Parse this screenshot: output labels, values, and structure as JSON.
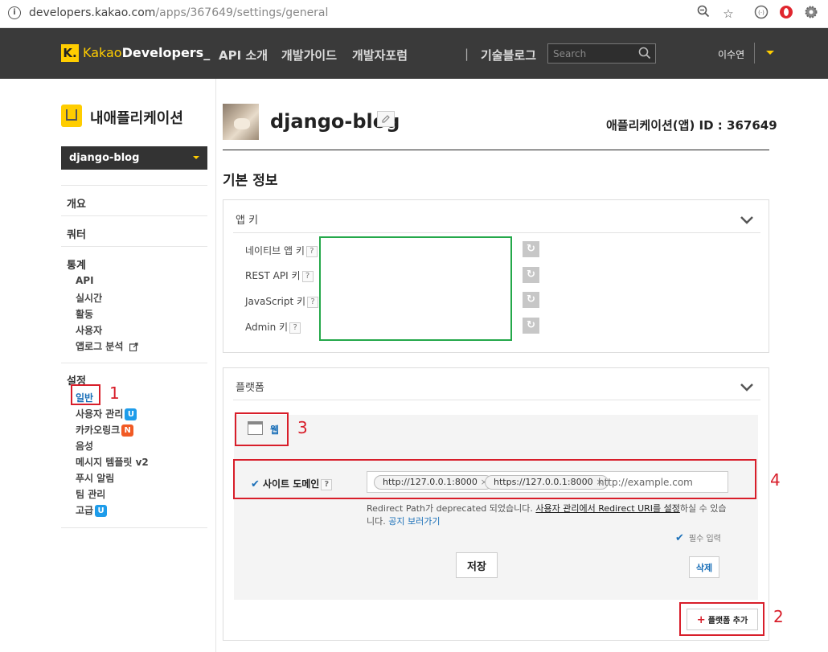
{
  "browser": {
    "url_host": "developers.kakao.com",
    "url_path": "/apps/367649/settings/general"
  },
  "header": {
    "logo_k": "K.",
    "logo_kakao": "Kakao",
    "logo_dev": "Developers_",
    "nav": [
      "API 소개",
      "개발가이드",
      "개발자포럼"
    ],
    "nav_sep": "|",
    "blog": "기술블로그",
    "search_placeholder": "Search",
    "user": "이수연"
  },
  "sidebar": {
    "title": "내애플리케이션",
    "app_select": "django-blog",
    "overview": "개요",
    "quota": "쿼터",
    "stats": {
      "label": "통계",
      "items": [
        "API",
        "실시간",
        "활동",
        "사용자",
        "앱로그 분석"
      ]
    },
    "settings": {
      "label": "설정",
      "items": [
        {
          "label": "일반",
          "badge": ""
        },
        {
          "label": "사용자 관리",
          "badge": "U"
        },
        {
          "label": "카카오링크",
          "badge": "N"
        },
        {
          "label": "음성",
          "badge": ""
        },
        {
          "label": "메시지 템플릿 v2",
          "badge": ""
        },
        {
          "label": "푸시 알림",
          "badge": ""
        },
        {
          "label": "팀 관리",
          "badge": ""
        },
        {
          "label": "고급",
          "badge": "U"
        }
      ]
    }
  },
  "annotations": [
    "1",
    "2",
    "3",
    "4"
  ],
  "main": {
    "app_name": "django-blog",
    "app_id": "애플리케이션(앱) ID : 367649",
    "section_title": "기본 정보",
    "app_keys": {
      "title": "앱 키",
      "labels": [
        "네이티브 앱 키",
        "REST API 키",
        "JavaScript 키",
        "Admin 키"
      ]
    },
    "platform": {
      "title": "플랫폼",
      "web_tab": "웹",
      "site_domain_label": "사이트 도메인",
      "domains": [
        "http://127.0.0.1:8000",
        "https://127.0.0.1:8000"
      ],
      "domain_placeholder": "http://example.com",
      "notice_pre": "Redirect Path가 deprecated 되었습니다. ",
      "notice_link": "사용자 관리에서 Redirect URI를 설정",
      "notice_post": "하실 수 있습니다. ",
      "notice_more": "공지 보러가기",
      "required": "필수 입력",
      "save_button": "저장",
      "delete_button": "삭제",
      "add_platform_button": "플랫폼 추가"
    }
  },
  "colors": {
    "accent": "#ffcd00",
    "header_bg": "#3a3a3a",
    "annotation": "#d81e2a",
    "masked_box": "#24a84a",
    "link": "#1a6fb8"
  }
}
